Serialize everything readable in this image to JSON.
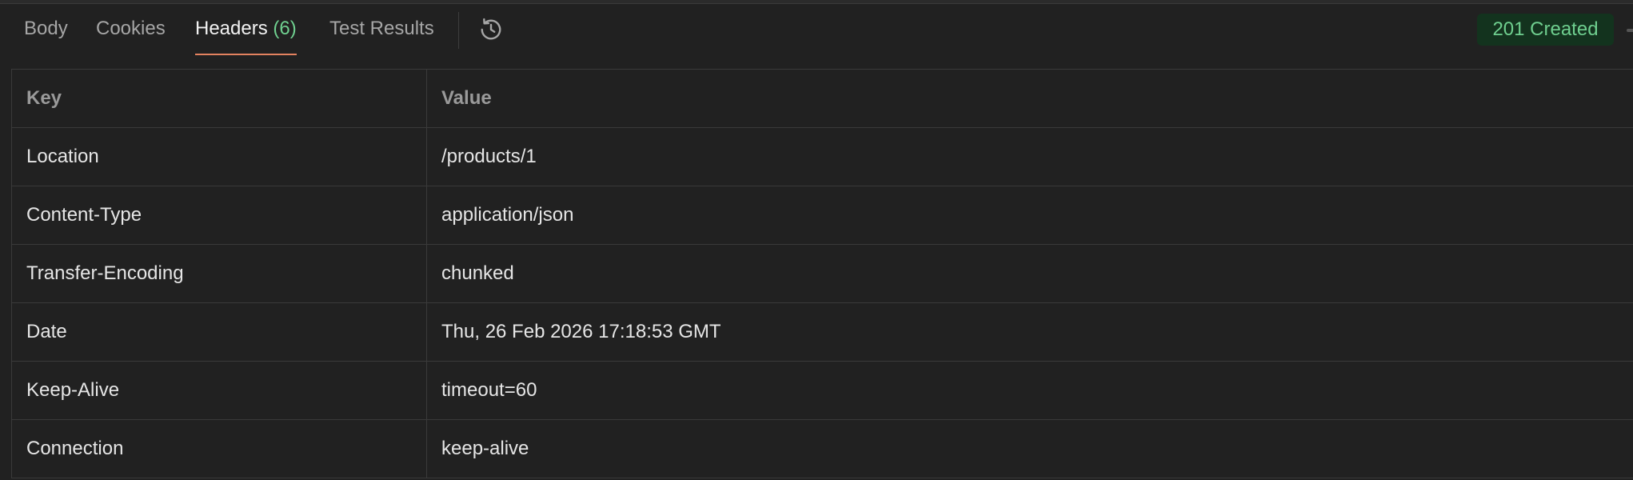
{
  "tabs": [
    {
      "label": "Body",
      "count": ""
    },
    {
      "label": "Cookies",
      "count": ""
    },
    {
      "label": "Headers",
      "count": "(6)"
    },
    {
      "label": "Test Results",
      "count": ""
    }
  ],
  "active_tab": "Headers",
  "icons": {
    "history": "history-icon"
  },
  "status": {
    "text": "201 Created",
    "color": "#6fcf8f",
    "background": "#13331e"
  },
  "accent": "#e3825f",
  "table": {
    "columns": [
      "Key",
      "Value"
    ],
    "rows": [
      {
        "key": "Location",
        "value": "/products/1"
      },
      {
        "key": "Content-Type",
        "value": "application/json"
      },
      {
        "key": "Transfer-Encoding",
        "value": "chunked"
      },
      {
        "key": "Date",
        "value": "Thu, 26 Feb 2026 17:18:53 GMT"
      },
      {
        "key": "Keep-Alive",
        "value": "timeout=60"
      },
      {
        "key": "Connection",
        "value": "keep-alive"
      }
    ]
  }
}
